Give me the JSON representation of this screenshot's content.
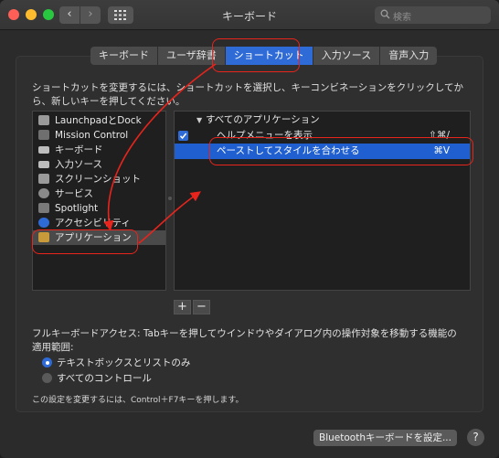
{
  "window": {
    "title": "キーボード"
  },
  "toolbar": {
    "back_glyph": "‹",
    "forward_glyph": "›",
    "grid_icon": "grid-icon",
    "search_placeholder": "検索",
    "search_icon": "search-icon"
  },
  "tabs": [
    {
      "label": "キーボード",
      "active": false
    },
    {
      "label": "ユーザ辞書",
      "active": false
    },
    {
      "label": "ショートカット",
      "active": true
    },
    {
      "label": "入力ソース",
      "active": false
    },
    {
      "label": "音声入力",
      "active": false
    }
  ],
  "description": "ショートカットを変更するには、ショートカットを選択し、キーコンビネーションをクリックしてから、新しいキーを押してください。",
  "categories": [
    {
      "label": "LaunchpadとDock",
      "icon": "launchpad-icon",
      "color": "#9a9a9a",
      "selected": false
    },
    {
      "label": "Mission Control",
      "icon": "mission-control-icon",
      "color": "#6f6f6f",
      "selected": false
    },
    {
      "label": "キーボード",
      "icon": "keyboard-icon",
      "color": "#bdbdbd",
      "selected": false
    },
    {
      "label": "入力ソース",
      "icon": "input-source-icon",
      "color": "#bdbdbd",
      "selected": false
    },
    {
      "label": "スクリーンショット",
      "icon": "screenshot-icon",
      "color": "#9a9a9a",
      "selected": false
    },
    {
      "label": "サービス",
      "icon": "gear-icon",
      "color": "#8a8a8a",
      "selected": false
    },
    {
      "label": "Spotlight",
      "icon": "spotlight-icon",
      "color": "#7a7a7a",
      "selected": false
    },
    {
      "label": "アクセシビリティ",
      "icon": "accessibility-icon",
      "color": "#2f6bd6",
      "selected": false
    },
    {
      "label": "アプリケーション",
      "icon": "applications-icon",
      "color": "#c99a3a",
      "selected": true
    }
  ],
  "shortcuts": {
    "group_label": "すべてのアプリケーション",
    "rows": [
      {
        "label": "ヘルプメニューを表示",
        "key": "⇧⌘/",
        "checked": true
      },
      {
        "label": "ペーストしてスタイルを合わせる",
        "key": "⌘V",
        "checked": false
      }
    ]
  },
  "buttons": {
    "add": "+",
    "remove": "−",
    "bluetooth": "Bluetoothキーボードを設定...",
    "help": "?"
  },
  "full_keyboard_access": {
    "text": "フルキーボードアクセス: Tabキーを押してウインドウやダイアログ内の操作対象を移動する機能の適用範囲:",
    "options": [
      {
        "label": "テキストボックスとリストのみ",
        "selected": true
      },
      {
        "label": "すべてのコントロール",
        "selected": false
      }
    ],
    "note": "この設定を変更するには、Control＋F7キーを押します。"
  },
  "colors": {
    "accent": "#2f6bd6",
    "annotation": "#e8241c"
  }
}
